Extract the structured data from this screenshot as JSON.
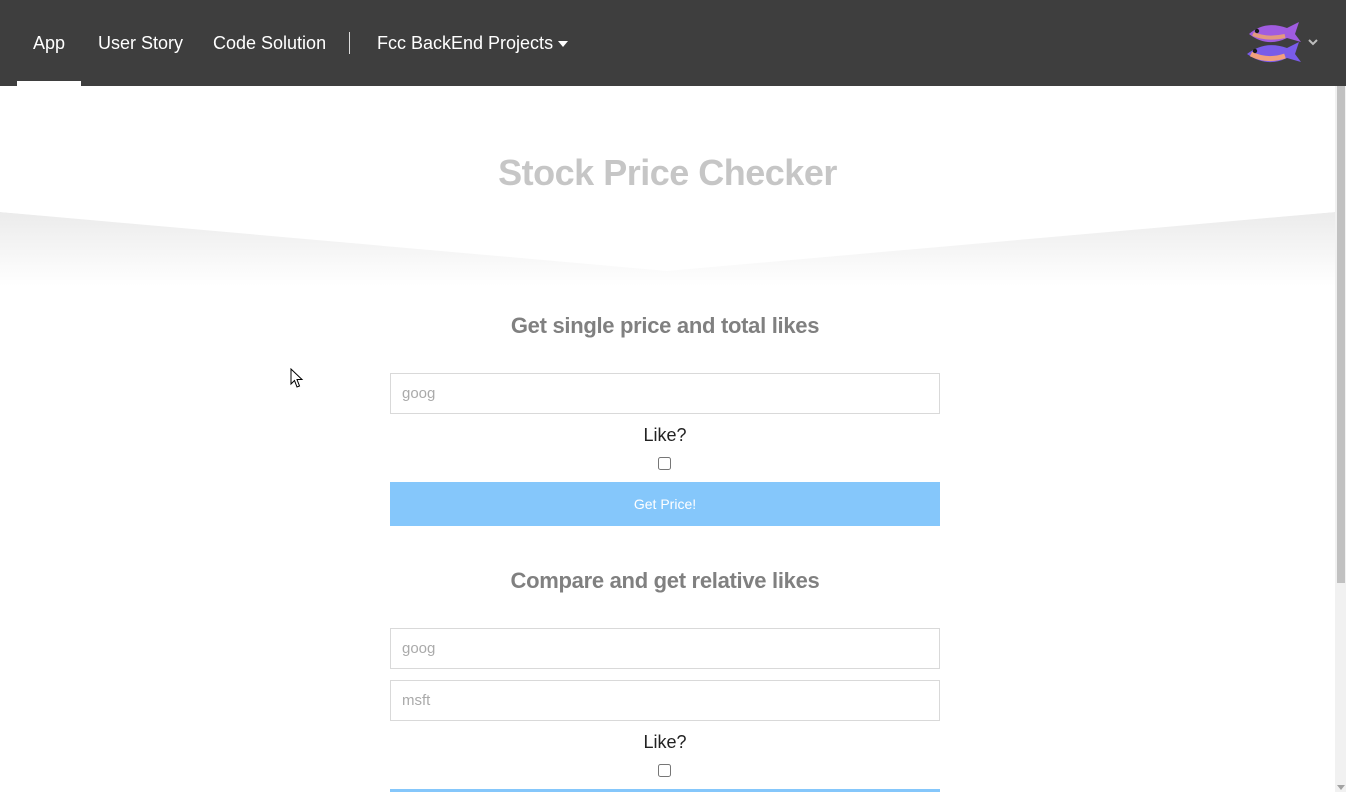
{
  "nav": {
    "items": [
      {
        "label": "App",
        "active": true
      },
      {
        "label": "User Story",
        "active": false
      },
      {
        "label": "Code Solution",
        "active": false
      }
    ],
    "dropdown_label": "Fcc BackEnd Projects",
    "background": "#3e3e3e"
  },
  "hero": {
    "title": "Stock Price Checker"
  },
  "single": {
    "heading": "Get single price and total likes",
    "stock_placeholder": "goog",
    "like_label": "Like?",
    "button_label": "Get Price!"
  },
  "compare": {
    "heading": "Compare and get relative likes",
    "stock1_placeholder": "goog",
    "stock2_placeholder": "msft",
    "like_label": "Like?"
  },
  "colors": {
    "accent": "#85c7fb",
    "title": "#c6c6c6",
    "heading": "#808080"
  },
  "icons": [
    "avatar-fish-icon",
    "chevron-down-icon",
    "caret-down-icon",
    "mouse-pointer-icon"
  ]
}
